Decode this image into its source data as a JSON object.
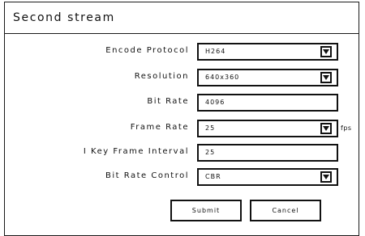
{
  "dialog": {
    "title": "Second stream"
  },
  "form": {
    "encode_protocol": {
      "label": "Encode Protocol",
      "value": "H264"
    },
    "resolution": {
      "label": "Resolution",
      "value": "640x360"
    },
    "bit_rate": {
      "label": "Bit Rate",
      "value": "4096"
    },
    "frame_rate": {
      "label": "Frame Rate",
      "value": "25",
      "unit": "fps"
    },
    "i_key_frame_interval": {
      "label": "I Key Frame Interval",
      "value": "25"
    },
    "bit_rate_control": {
      "label": "Bit Rate Control",
      "value": "CBR"
    }
  },
  "buttons": {
    "submit": "Submit",
    "cancel": "Cancel"
  },
  "icons": {
    "dropdown": "chevron-down-icon"
  },
  "colors": {
    "border": "#111111",
    "background": "#ffffff"
  }
}
